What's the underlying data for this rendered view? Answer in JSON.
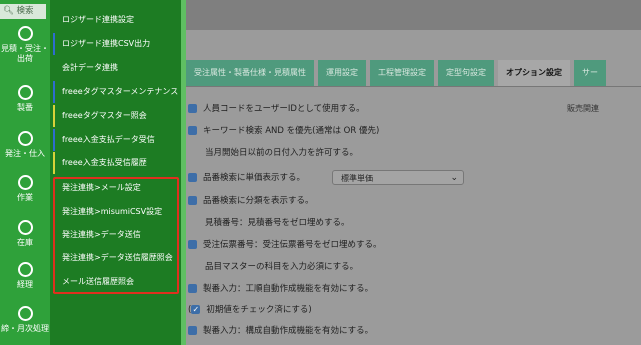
{
  "sidebar": {
    "search_label": "検索",
    "items": [
      {
        "label": "見積・受注・出荷"
      },
      {
        "label": "製番"
      },
      {
        "label": "発注・仕入"
      },
      {
        "label": "作業"
      },
      {
        "label": "在庫"
      },
      {
        "label": "経理"
      },
      {
        "label": "締・月次処理"
      }
    ]
  },
  "menu": {
    "items": [
      {
        "label": "ロジザード連携設定",
        "accent": "#1d7c23"
      },
      {
        "label": "ロジザード連携CSV出力",
        "accent": "#2f6ccf"
      },
      {
        "label": "会計データ連携",
        "accent": "#1d7c23"
      },
      {
        "label": "freeeタグマスターメンテナンス",
        "accent": "#2f6ccf"
      },
      {
        "label": "freeeタグマスター照会",
        "accent": "#d8d23a"
      },
      {
        "label": "freee入金支払データ受信",
        "accent": "#2f6ccf"
      },
      {
        "label": "freee入金支払受信履歴",
        "accent": "#d8d23a"
      },
      {
        "label": "発注連携>メール設定",
        "accent": "#1d7c23"
      },
      {
        "label": "発注連携>misumiCSV設定",
        "accent": "#1d7c23"
      },
      {
        "label": "発注連携>データ送信",
        "accent": "#2f6ccf"
      },
      {
        "label": "発注連携>データ送信履歴照会",
        "accent": "#d8d23a"
      },
      {
        "label": "メール送信履歴照会",
        "accent": "#d8d23a"
      }
    ]
  },
  "tabs": [
    {
      "label": "受注属性・製番仕様・見積属性"
    },
    {
      "label": "運用設定"
    },
    {
      "label": "工程管理設定"
    },
    {
      "label": "定型句設定"
    },
    {
      "label": "オプション設定",
      "active": true
    },
    {
      "label": "サー"
    }
  ],
  "right_label": "販売関連",
  "options": [
    {
      "label": "人員コードをユーザーIDとして使用する。",
      "checked": true
    },
    {
      "label": "キーワード検索 AND を優先(通常は OR 優先)",
      "checked": true
    },
    {
      "label": "当月開始日以前の日付入力を許可する。",
      "checked": false
    },
    {
      "label": "品番検索に単価表示する。",
      "checked": true
    },
    {
      "label": "品番検索に分類を表示する。",
      "checked": true
    },
    {
      "label": "見積番号：見積番号をゼロ埋めする。",
      "checked": false
    },
    {
      "label": "受注伝票番号：受注伝票番号をゼロ埋めする。",
      "checked": true
    },
    {
      "label": "品目マスターの科目を入力必須にする。",
      "checked": false
    },
    {
      "label": "製番入力：工順自動作成機能を有効にする。",
      "checked": true
    },
    {
      "label": "初期値をチェック済にする)",
      "checked": true,
      "prefix": "("
    },
    {
      "label": "製番入力：構成自動作成機能を有効にする。",
      "checked": true
    }
  ],
  "unit_price_select": {
    "value": "標準単価"
  }
}
